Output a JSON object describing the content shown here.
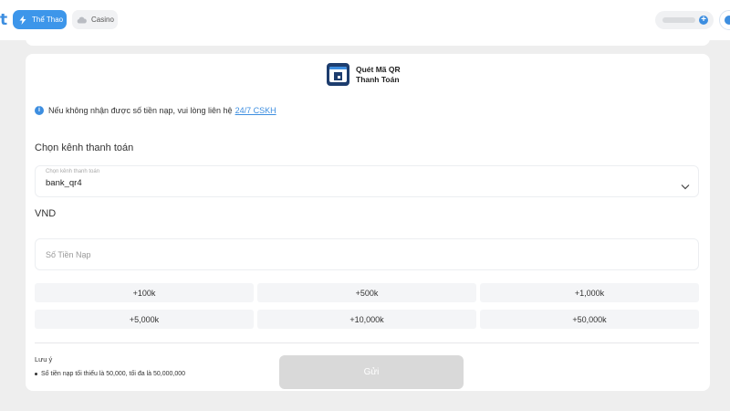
{
  "header": {
    "logo_letter": "t",
    "tabs": [
      {
        "label": "Thể Thao",
        "icon": "lightning-icon",
        "active": true
      },
      {
        "label": "Casino",
        "icon": "cloud-icon",
        "active": false
      }
    ],
    "balance_action_icon": "plus-icon",
    "avatar_icon": "user-icon"
  },
  "payment_method": {
    "icon": "qr-scan-icon",
    "line1": "Quét Mã QR",
    "line2": "Thanh Toán"
  },
  "notice": {
    "icon": "info-icon",
    "text": "Nếu không nhận được số tiền nạp, vui lòng liên hệ",
    "link": "24/7 CSKH"
  },
  "channel": {
    "section_title": "Chọn kênh thanh toán",
    "field_label": "Chọn kênh thanh toán",
    "selected": "bank_qr4"
  },
  "currency": {
    "label": "VND"
  },
  "amount": {
    "placeholder": "Số Tiền Nạp",
    "value": ""
  },
  "quick_amounts": [
    "+100k",
    "+500k",
    "+1,000k",
    "+5,000k",
    "+10,000k",
    "+50,000k"
  ],
  "note": {
    "title": "Lưu ý",
    "items": [
      "Số tiền nạp tối thiểu là 50,000, tối đa là 50,000,000"
    ]
  },
  "submit_label": "Gửi",
  "colors": {
    "accent": "#3d8ee0",
    "active_tab": "#3d96ea",
    "background": "#eeeeee",
    "disabled_button": "#d9d9d9"
  }
}
